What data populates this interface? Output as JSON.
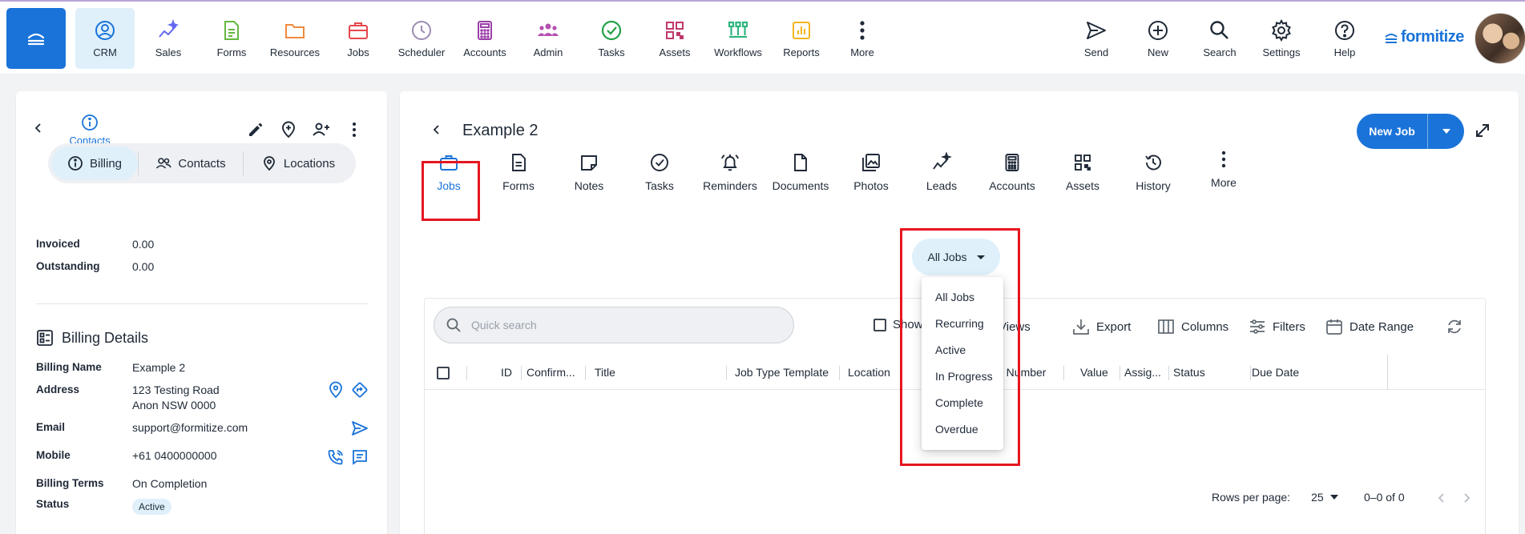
{
  "colors": {
    "accent": "#1a73d9",
    "active_bg": "#dff0fb",
    "highlight": "#e5161f"
  },
  "topnav": {
    "items": [
      {
        "label": "CRM",
        "icon": "crm-icon",
        "color": "#1a73d9"
      },
      {
        "label": "Sales",
        "icon": "sparkle-chart-icon",
        "color": "#6366f1"
      },
      {
        "label": "Forms",
        "icon": "form-icon",
        "color": "#65b741"
      },
      {
        "label": "Resources",
        "icon": "folder-icon",
        "color": "#f08a3c"
      },
      {
        "label": "Jobs",
        "icon": "briefcase-icon",
        "color": "#e5484d"
      },
      {
        "label": "Scheduler",
        "icon": "clock-icon",
        "color": "#9b8bb4"
      },
      {
        "label": "Accounts",
        "icon": "calculator-icon",
        "color": "#9b3fa8"
      },
      {
        "label": "Admin",
        "icon": "users-icon",
        "color": "#b44fb0"
      },
      {
        "label": "Tasks",
        "icon": "check-circle-icon",
        "color": "#22a046"
      },
      {
        "label": "Assets",
        "icon": "qr-icon",
        "color": "#c0386b"
      },
      {
        "label": "Workflows",
        "icon": "workflow-icon",
        "color": "#2fb57e"
      },
      {
        "label": "Reports",
        "icon": "bar-chart-icon",
        "color": "#f2b51c"
      },
      {
        "label": "More",
        "icon": "more-vertical-icon",
        "color": "#1f2937"
      }
    ],
    "right_items": [
      {
        "label": "Send",
        "icon": "send-icon"
      },
      {
        "label": "New",
        "icon": "plus-circle-icon"
      },
      {
        "label": "Search",
        "icon": "search-icon"
      },
      {
        "label": "Settings",
        "icon": "gear-icon"
      },
      {
        "label": "Help",
        "icon": "help-icon"
      }
    ],
    "logo": "formitize"
  },
  "left_panel": {
    "contacts_label": "Contacts",
    "segments": [
      "Billing",
      "Contacts",
      "Locations"
    ],
    "totals": [
      {
        "label": "Invoiced",
        "value": "0.00"
      },
      {
        "label": "Outstanding",
        "value": "0.00"
      }
    ],
    "billing_details_title": "Billing Details",
    "billing": {
      "name_label": "Billing Name",
      "name": "Example 2",
      "address_label": "Address",
      "address_line1": "123 Testing Road",
      "address_line2": "Anon NSW 0000",
      "email_label": "Email",
      "email": "support@formitize.com",
      "mobile_label": "Mobile",
      "mobile": "+61 0400000000",
      "terms_label": "Billing Terms",
      "terms": "On Completion",
      "status_label": "Status",
      "status": "Active"
    }
  },
  "main": {
    "title": "Example 2",
    "new_job_label": "New Job",
    "tabs": [
      "Jobs",
      "Forms",
      "Notes",
      "Tasks",
      "Reminders",
      "Documents",
      "Photos",
      "Leads",
      "Accounts",
      "Assets",
      "History",
      "More"
    ],
    "filter_selected": "All Jobs",
    "filter_options": [
      "All Jobs",
      "Recurring",
      "Active",
      "In Progress",
      "Complete",
      "Overdue"
    ],
    "search_placeholder": "Quick search",
    "toolbar": {
      "show": "Show",
      "views": "Views",
      "export": "Export",
      "columns": "Columns",
      "filters": "Filters",
      "date_range": "Date Range"
    },
    "columns": [
      "ID",
      "Confirm...",
      "Title",
      "Job Type Template",
      "Location",
      "o Number",
      "Value",
      "Assig...",
      "Status",
      "Due Date"
    ],
    "rows_per_page_label": "Rows per page:",
    "rows_per_page": "25",
    "pagination_range": "0–0 of 0"
  }
}
